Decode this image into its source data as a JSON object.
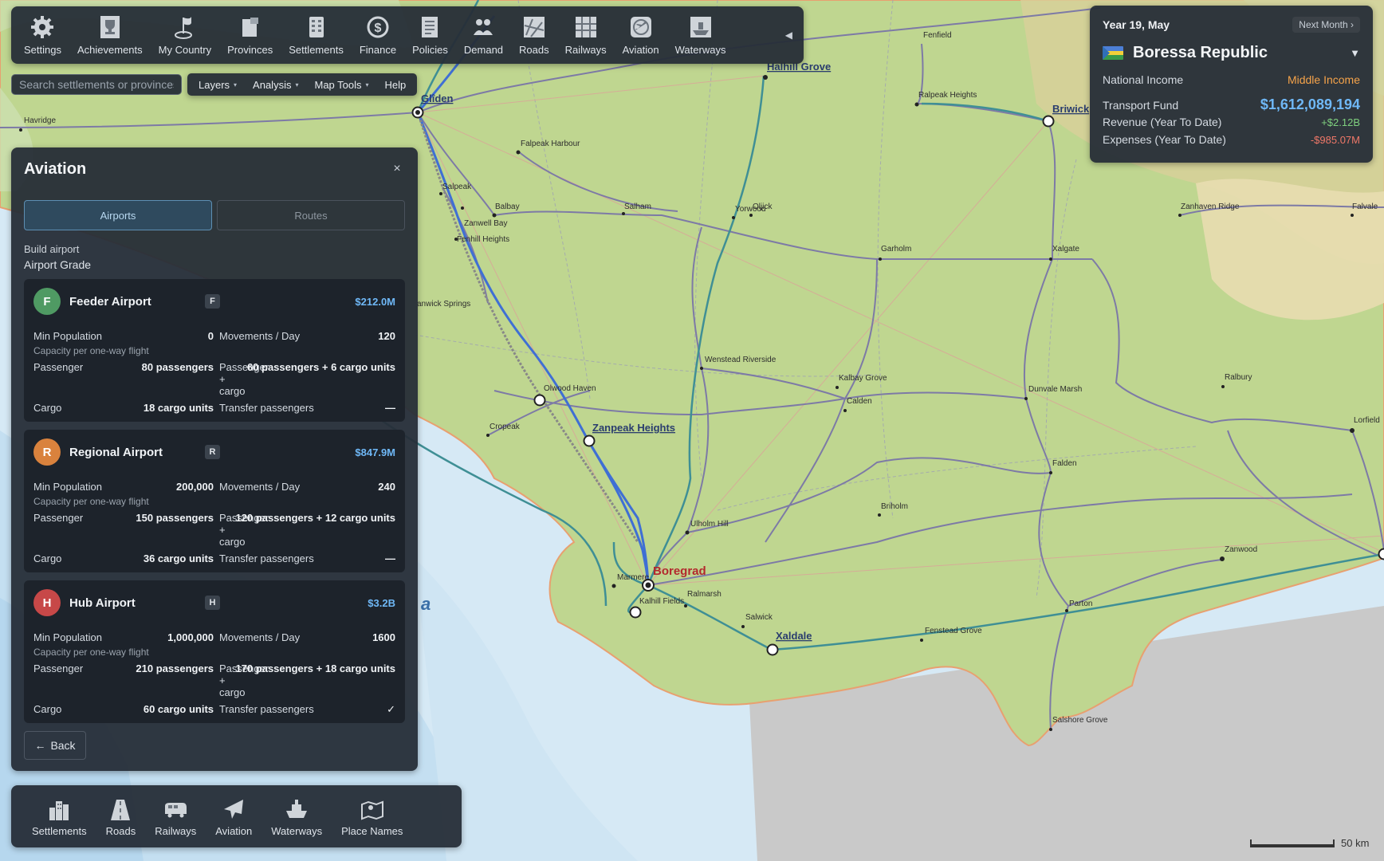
{
  "top_toolbar": {
    "items": [
      {
        "label": "Settings",
        "icon": "gear-icon"
      },
      {
        "label": "Achievements",
        "icon": "trophy-icon"
      },
      {
        "label": "My Country",
        "icon": "flag-icon"
      },
      {
        "label": "Provinces",
        "icon": "map-pieces-icon"
      },
      {
        "label": "Settlements",
        "icon": "building-icon"
      },
      {
        "label": "Finance",
        "icon": "dollar-coin-icon"
      },
      {
        "label": "Policies",
        "icon": "document-icon"
      },
      {
        "label": "Demand",
        "icon": "people-icon"
      },
      {
        "label": "Roads",
        "icon": "road-map-icon"
      },
      {
        "label": "Railways",
        "icon": "railway-map-icon"
      },
      {
        "label": "Aviation",
        "icon": "airplane-globe-icon"
      },
      {
        "label": "Waterways",
        "icon": "ship-icon"
      }
    ],
    "collapse_glyph": "◀"
  },
  "search": {
    "placeholder": "Search settlements or provinces"
  },
  "menu": {
    "items": [
      {
        "label": "Layers",
        "has_caret": true
      },
      {
        "label": "Analysis",
        "has_caret": true
      },
      {
        "label": "Map Tools",
        "has_caret": true
      },
      {
        "label": "Help",
        "has_caret": false
      }
    ]
  },
  "info_panel": {
    "date": "Year 19, May",
    "next_month": "Next Month ›",
    "country": "Boressa Republic",
    "dropdown": "▼",
    "national_income_label": "National Income",
    "national_income_value": "Middle Income",
    "transport_fund_label": "Transport Fund",
    "transport_fund_value": "$1,612,089,194",
    "revenue_label": "Revenue (Year To Date)",
    "revenue_value": "+$2.12B",
    "expenses_label": "Expenses (Year To Date)",
    "expenses_value": "-$985.07M",
    "colors": {
      "income": "#f5a34a",
      "fund": "#6fb8f7",
      "revenue": "#7fd07f",
      "expenses": "#f07868"
    }
  },
  "aviation_panel": {
    "title": "Aviation",
    "close": "×",
    "tabs": {
      "airports": "Airports",
      "routes": "Routes"
    },
    "build_label": "Build airport",
    "grade_label": "Airport Grade",
    "back": "Back",
    "back_icon": "←",
    "common": {
      "min_population": "Min Population",
      "movements": "Movements / Day",
      "capacity_note": "Capacity per one-way flight",
      "passenger": "Passenger",
      "passenger_cargo": "Passenger + cargo",
      "cargo": "Cargo",
      "transfer": "Transfer passengers"
    },
    "airports": [
      {
        "grade_letter": "F",
        "name": "Feeder Airport",
        "badge": "F",
        "price": "$212.0M",
        "color": "#4f9a63",
        "min_population": "0",
        "movements": "120",
        "passenger": "80 passengers",
        "passenger_cargo": "60 passengers + 6 cargo units",
        "cargo": "18 cargo units",
        "transfer": "—"
      },
      {
        "grade_letter": "R",
        "name": "Regional Airport",
        "badge": "R",
        "price": "$847.9M",
        "color": "#d9823d",
        "min_population": "200,000",
        "movements": "240",
        "passenger": "150 passengers",
        "passenger_cargo": "120 passengers + 12 cargo units",
        "cargo": "36 cargo units",
        "transfer": "—"
      },
      {
        "grade_letter": "H",
        "name": "Hub Airport",
        "badge": "H",
        "price": "$3.2B",
        "color": "#c74848",
        "min_population": "1,000,000",
        "movements": "1600",
        "passenger": "210 passengers",
        "passenger_cargo": "170 passengers + 18 cargo units",
        "cargo": "60 cargo units",
        "transfer": "✓"
      }
    ]
  },
  "bottom_toolbar": {
    "items": [
      {
        "label": "Settlements",
        "icon": "city-icon"
      },
      {
        "label": "Roads",
        "icon": "road-icon"
      },
      {
        "label": "Railways",
        "icon": "train-icon"
      },
      {
        "label": "Aviation",
        "icon": "airplane-icon"
      },
      {
        "label": "Waterways",
        "icon": "ship-icon"
      },
      {
        "label": "Place Names",
        "icon": "map-label-icon"
      }
    ]
  },
  "map": {
    "major_places": [
      "Glîden",
      "Halhill Grove",
      "Briwick",
      "Zanpeak Heights",
      "Boregrad",
      "Xaldale"
    ],
    "places": [
      "Fenfield",
      "Ralpeak Heights",
      "Havridge",
      "Falpeak Harbour",
      "Salpeak",
      "Balbay",
      "Zanwell Bay",
      "Fenhill Heights",
      "Salham",
      "Yorwood",
      "Oljick",
      "Zanhaven Ridge",
      "Falvale",
      "Garholm",
      "Xalgate",
      "anwick Springs",
      "Olwood Haven",
      "Wenstead Riverside",
      "Kalbay Grove",
      "Calden",
      "Dunvale Marsh",
      "Ralbury",
      "Lorfield",
      "Cropeak",
      "Falden",
      "Briholm",
      "Ulholm Hill",
      "Marmere",
      "Ralmarsh",
      "Kalhill Fields",
      "Salwick",
      "Fenstead Grove",
      "Parton",
      "Zanwood",
      "Salshore Grove"
    ],
    "sea_label": "a",
    "scale": "50 km"
  }
}
